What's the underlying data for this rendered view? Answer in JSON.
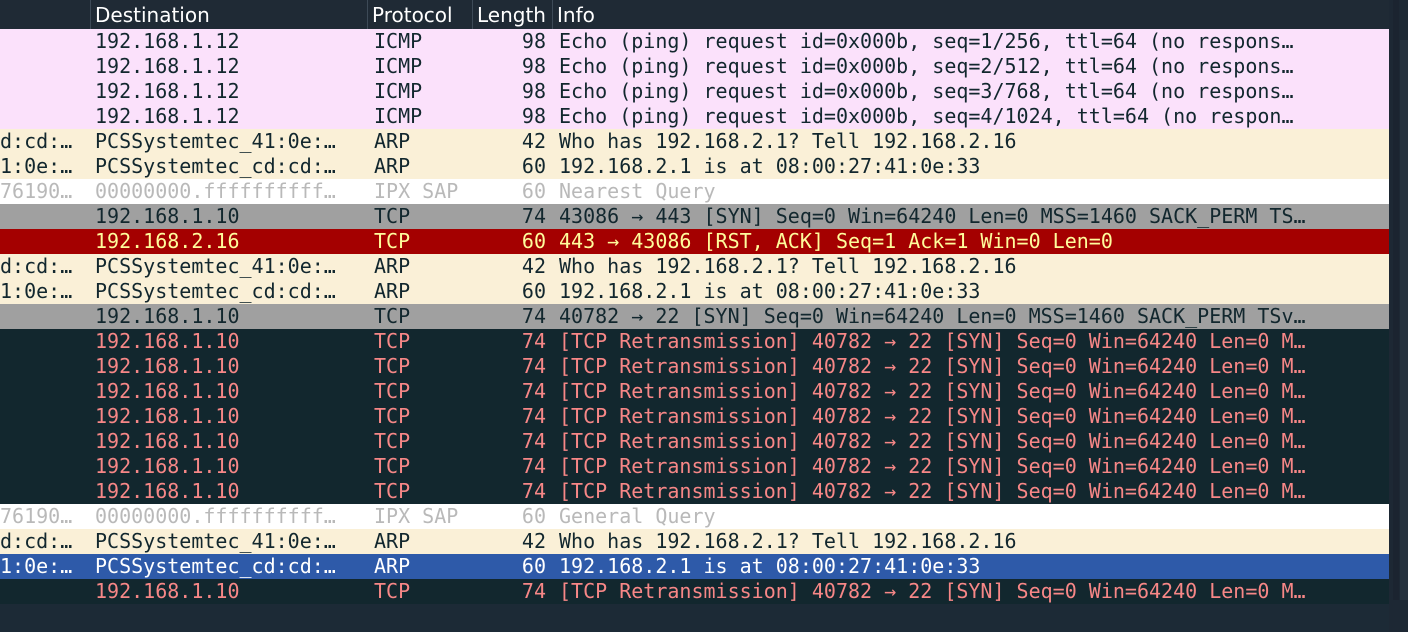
{
  "columns": {
    "destination": "Destination",
    "protocol": "Protocol",
    "length": "Length",
    "info": "Info"
  },
  "colors": {
    "icmp_bg": "#fbe1fb",
    "arp_bg": "#faf0d7",
    "ipx_bg": "#ffffff",
    "syn_bg": "#a0a0a0",
    "rst_bg": "#a40000",
    "retx_bg": "#12272e",
    "selected_bg": "#2e5aa9"
  },
  "packets": [
    {
      "src": "",
      "dst": "192.168.1.12",
      "proto": "ICMP",
      "len": "98",
      "info": "Echo (ping) request  id=0x000b, seq=1/256, ttl=64 (no respons…",
      "kind": "icmp"
    },
    {
      "src": "",
      "dst": "192.168.1.12",
      "proto": "ICMP",
      "len": "98",
      "info": "Echo (ping) request  id=0x000b, seq=2/512, ttl=64 (no respons…",
      "kind": "icmp"
    },
    {
      "src": "",
      "dst": "192.168.1.12",
      "proto": "ICMP",
      "len": "98",
      "info": "Echo (ping) request  id=0x000b, seq=3/768, ttl=64 (no respons…",
      "kind": "icmp"
    },
    {
      "src": "",
      "dst": "192.168.1.12",
      "proto": "ICMP",
      "len": "98",
      "info": "Echo (ping) request  id=0x000b, seq=4/1024, ttl=64 (no respon…",
      "kind": "icmp"
    },
    {
      "src": "d:cd:…",
      "dst": "PCSSystemtec_41:0e:…",
      "proto": "ARP",
      "len": "42",
      "info": "Who has 192.168.2.1? Tell 192.168.2.16",
      "kind": "arp"
    },
    {
      "src": "1:0e:…",
      "dst": "PCSSystemtec_cd:cd:…",
      "proto": "ARP",
      "len": "60",
      "info": "192.168.2.1 is at 08:00:27:41:0e:33",
      "kind": "arp"
    },
    {
      "src": "76190…",
      "dst": "00000000.ffffffffff…",
      "proto": "IPX SAP",
      "len": "60",
      "info": "Nearest Query",
      "kind": "ipx"
    },
    {
      "src": "",
      "dst": "192.168.1.10",
      "proto": "TCP",
      "len": "74",
      "info": "43086 → 443 [SYN] Seq=0 Win=64240 Len=0 MSS=1460 SACK_PERM TS…",
      "kind": "syn"
    },
    {
      "src": "",
      "dst": "192.168.2.16",
      "proto": "TCP",
      "len": "60",
      "info": "443 → 43086 [RST, ACK] Seq=1 Ack=1 Win=0 Len=0",
      "kind": "rst"
    },
    {
      "src": "d:cd:…",
      "dst": "PCSSystemtec_41:0e:…",
      "proto": "ARP",
      "len": "42",
      "info": "Who has 192.168.2.1? Tell 192.168.2.16",
      "kind": "arp"
    },
    {
      "src": "1:0e:…",
      "dst": "PCSSystemtec_cd:cd:…",
      "proto": "ARP",
      "len": "60",
      "info": "192.168.2.1 is at 08:00:27:41:0e:33",
      "kind": "arp"
    },
    {
      "src": "",
      "dst": "192.168.1.10",
      "proto": "TCP",
      "len": "74",
      "info": "40782 → 22 [SYN] Seq=0 Win=64240 Len=0 MSS=1460 SACK_PERM TSv…",
      "kind": "syn"
    },
    {
      "src": "",
      "dst": "192.168.1.10",
      "proto": "TCP",
      "len": "74",
      "info": "[TCP Retransmission] 40782 → 22 [SYN] Seq=0 Win=64240 Len=0 M…",
      "kind": "retx"
    },
    {
      "src": "",
      "dst": "192.168.1.10",
      "proto": "TCP",
      "len": "74",
      "info": "[TCP Retransmission] 40782 → 22 [SYN] Seq=0 Win=64240 Len=0 M…",
      "kind": "retx"
    },
    {
      "src": "",
      "dst": "192.168.1.10",
      "proto": "TCP",
      "len": "74",
      "info": "[TCP Retransmission] 40782 → 22 [SYN] Seq=0 Win=64240 Len=0 M…",
      "kind": "retx"
    },
    {
      "src": "",
      "dst": "192.168.1.10",
      "proto": "TCP",
      "len": "74",
      "info": "[TCP Retransmission] 40782 → 22 [SYN] Seq=0 Win=64240 Len=0 M…",
      "kind": "retx"
    },
    {
      "src": "",
      "dst": "192.168.1.10",
      "proto": "TCP",
      "len": "74",
      "info": "[TCP Retransmission] 40782 → 22 [SYN] Seq=0 Win=64240 Len=0 M…",
      "kind": "retx"
    },
    {
      "src": "",
      "dst": "192.168.1.10",
      "proto": "TCP",
      "len": "74",
      "info": "[TCP Retransmission] 40782 → 22 [SYN] Seq=0 Win=64240 Len=0 M…",
      "kind": "retx"
    },
    {
      "src": "",
      "dst": "192.168.1.10",
      "proto": "TCP",
      "len": "74",
      "info": "[TCP Retransmission] 40782 → 22 [SYN] Seq=0 Win=64240 Len=0 M…",
      "kind": "retx"
    },
    {
      "src": "76190…",
      "dst": "00000000.ffffffffff…",
      "proto": "IPX SAP",
      "len": "60",
      "info": "General Query",
      "kind": "ipx"
    },
    {
      "src": "d:cd:…",
      "dst": "PCSSystemtec_41:0e:…",
      "proto": "ARP",
      "len": "42",
      "info": "Who has 192.168.2.1? Tell 192.168.2.16",
      "kind": "arp"
    },
    {
      "src": "1:0e:…",
      "dst": "PCSSystemtec_cd:cd:…",
      "proto": "ARP",
      "len": "60",
      "info": "192.168.2.1 is at 08:00:27:41:0e:33",
      "kind": "sel"
    },
    {
      "src": "",
      "dst": "192.168.1.10",
      "proto": "TCP",
      "len": "74",
      "info": "[TCP Retransmission] 40782 → 22 [SYN] Seq=0 Win=64240 Len=0 M…",
      "kind": "retx"
    }
  ]
}
